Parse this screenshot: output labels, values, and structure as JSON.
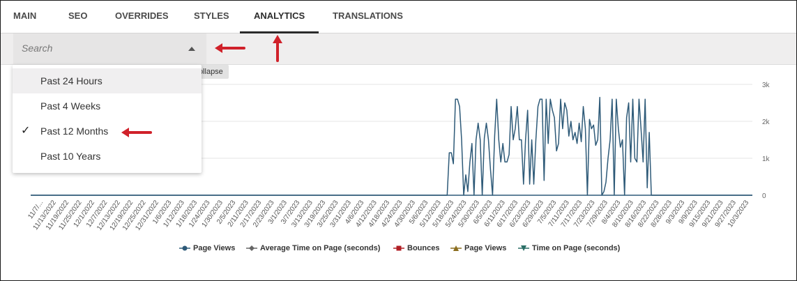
{
  "tabs": [
    {
      "label": "MAIN"
    },
    {
      "label": "SEO"
    },
    {
      "label": "OVERRIDES"
    },
    {
      "label": "STYLES"
    },
    {
      "label": "ANALYTICS",
      "active": true
    },
    {
      "label": "TRANSLATIONS"
    }
  ],
  "search": {
    "placeholder": "Search"
  },
  "tooltip": "Collapse",
  "dropdown": {
    "options": [
      {
        "label": "Past 24 Hours",
        "highlighted": true
      },
      {
        "label": "Past 4 Weeks"
      },
      {
        "label": "Past 12 Months",
        "selected": true
      },
      {
        "label": "Past 10 Years"
      }
    ]
  },
  "annotation_color": "#d0212a",
  "chart_data": {
    "type": "line",
    "y_ticks": [
      "3k",
      "2k",
      "1k",
      "0"
    ],
    "ylim": [
      0,
      3000
    ],
    "x_labels": [
      "11/7/...",
      "11/13/2022",
      "11/19/2022",
      "11/25/2022",
      "12/1/2022",
      "12/7/2022",
      "12/13/2022",
      "12/19/2022",
      "12/25/2022",
      "12/31/2022",
      "1/6/2023",
      "1/12/2023",
      "1/18/2023",
      "1/24/2023",
      "1/30/2023",
      "2/5/2023",
      "2/11/2023",
      "2/17/2023",
      "2/23/2023",
      "3/1/2023",
      "3/7/2023",
      "3/13/2023",
      "3/19/2023",
      "3/25/2023",
      "3/31/2023",
      "4/6/2023",
      "4/12/2023",
      "4/18/2023",
      "4/24/2023",
      "4/30/2023",
      "5/6/2023",
      "5/12/2023",
      "5/18/2023",
      "5/24/2023",
      "5/30/2023",
      "6/5/2023",
      "6/11/2023",
      "6/17/2023",
      "6/23/2023",
      "6/29/2023",
      "7/5/2023",
      "7/11/2023",
      "7/17/2023",
      "7/23/2023",
      "7/29/2023",
      "8/4/2023",
      "8/10/2023",
      "8/16/2023",
      "8/22/2023",
      "8/28/2023",
      "9/3/2023",
      "9/9/2023",
      "9/15/2023",
      "9/21/2023",
      "9/27/2023",
      "10/3/2023"
    ],
    "series": [
      {
        "name": "Page Views",
        "color": "#2e5a78",
        "marker": "circle",
        "values": [
          0,
          0,
          0,
          0,
          0,
          0,
          0,
          0,
          0,
          0,
          0,
          0,
          0,
          0,
          0,
          0,
          0,
          0,
          0,
          0,
          0,
          0,
          0,
          0,
          0,
          0,
          0,
          0,
          0,
          0,
          0,
          0,
          0,
          0,
          0,
          0,
          0,
          0,
          0,
          0,
          0,
          0,
          0,
          0,
          0,
          0,
          0,
          0,
          0,
          0,
          0,
          0,
          0,
          0,
          0,
          0,
          0,
          0,
          0,
          0,
          0,
          0,
          0,
          0,
          0,
          0,
          0,
          0,
          0,
          0,
          0,
          0,
          0,
          0,
          0,
          0,
          0,
          0,
          0,
          0,
          0,
          0,
          0,
          0,
          0,
          0,
          0,
          0,
          0,
          0,
          0,
          0,
          0,
          0,
          0,
          0,
          0,
          0,
          0,
          0,
          0,
          0,
          0,
          0,
          0,
          0,
          0,
          0,
          0,
          0,
          0,
          0,
          0,
          0,
          0,
          0,
          0,
          0,
          0,
          0,
          0,
          0,
          0,
          0,
          0,
          0,
          0,
          0,
          0,
          0,
          0,
          0,
          0,
          0,
          0,
          0,
          0,
          0,
          0,
          0,
          0,
          0,
          0,
          0,
          0,
          0,
          0,
          0,
          0,
          0,
          0,
          0,
          0,
          0,
          0,
          0,
          0,
          0,
          0,
          0,
          0,
          0,
          0,
          0,
          0,
          0,
          0,
          0,
          0,
          0,
          0,
          0,
          0,
          0,
          0,
          0,
          0,
          0,
          0,
          0,
          0,
          0,
          0,
          0,
          0,
          0,
          0,
          0,
          0,
          0,
          0,
          0,
          0,
          0,
          0,
          0,
          0,
          0,
          0,
          0,
          0,
          0,
          0,
          1150,
          1150,
          850,
          2600,
          2600,
          2400,
          1500,
          0,
          550,
          100,
          900,
          1400,
          0,
          1500,
          1950,
          1500,
          0,
          1550,
          1950,
          1500,
          700,
          0,
          1600,
          2600,
          1500,
          900,
          1400,
          900,
          900,
          1100,
          2400,
          1500,
          1800,
          2400,
          1500,
          1500,
          300,
          1500,
          2300,
          300,
          1500,
          300,
          1500,
          2400,
          2600,
          2600,
          400,
          2600,
          1400,
          2600,
          2300,
          2100,
          1200,
          1400,
          2600,
          1800,
          2500,
          2300,
          1600,
          2000,
          1500,
          1700,
          1400,
          1950,
          1450,
          2400,
          1800,
          0,
          2050,
          1800,
          1900,
          1350,
          1500,
          2650,
          0,
          100,
          350,
          1000,
          1500,
          2600,
          0,
          2600,
          1800,
          1300,
          1500,
          0,
          2100,
          2500,
          900,
          2600,
          1000,
          900,
          2600,
          1800,
          900,
          2600,
          200,
          1700,
          0,
          0,
          0,
          0,
          0,
          0,
          0,
          0,
          0,
          0,
          0,
          0,
          0,
          0,
          0,
          0,
          0,
          0,
          0,
          0,
          0,
          0,
          0,
          0,
          0,
          0,
          0,
          0,
          0,
          0,
          0,
          0,
          0,
          0,
          0,
          0,
          0,
          0,
          0,
          0,
          0,
          0,
          0,
          0,
          0,
          0,
          0,
          0,
          0,
          0
        ]
      },
      {
        "name": "Average Time on Page (seconds)",
        "color": "#666666",
        "marker": "diamond"
      },
      {
        "name": "Bounces",
        "color": "#b01e24",
        "marker": "square"
      },
      {
        "name": "Page Views",
        "color": "#8b6d1e",
        "marker": "triangle-up"
      },
      {
        "name": "Time on Page (seconds)",
        "color": "#2a6e66",
        "marker": "triangle-down"
      }
    ]
  }
}
